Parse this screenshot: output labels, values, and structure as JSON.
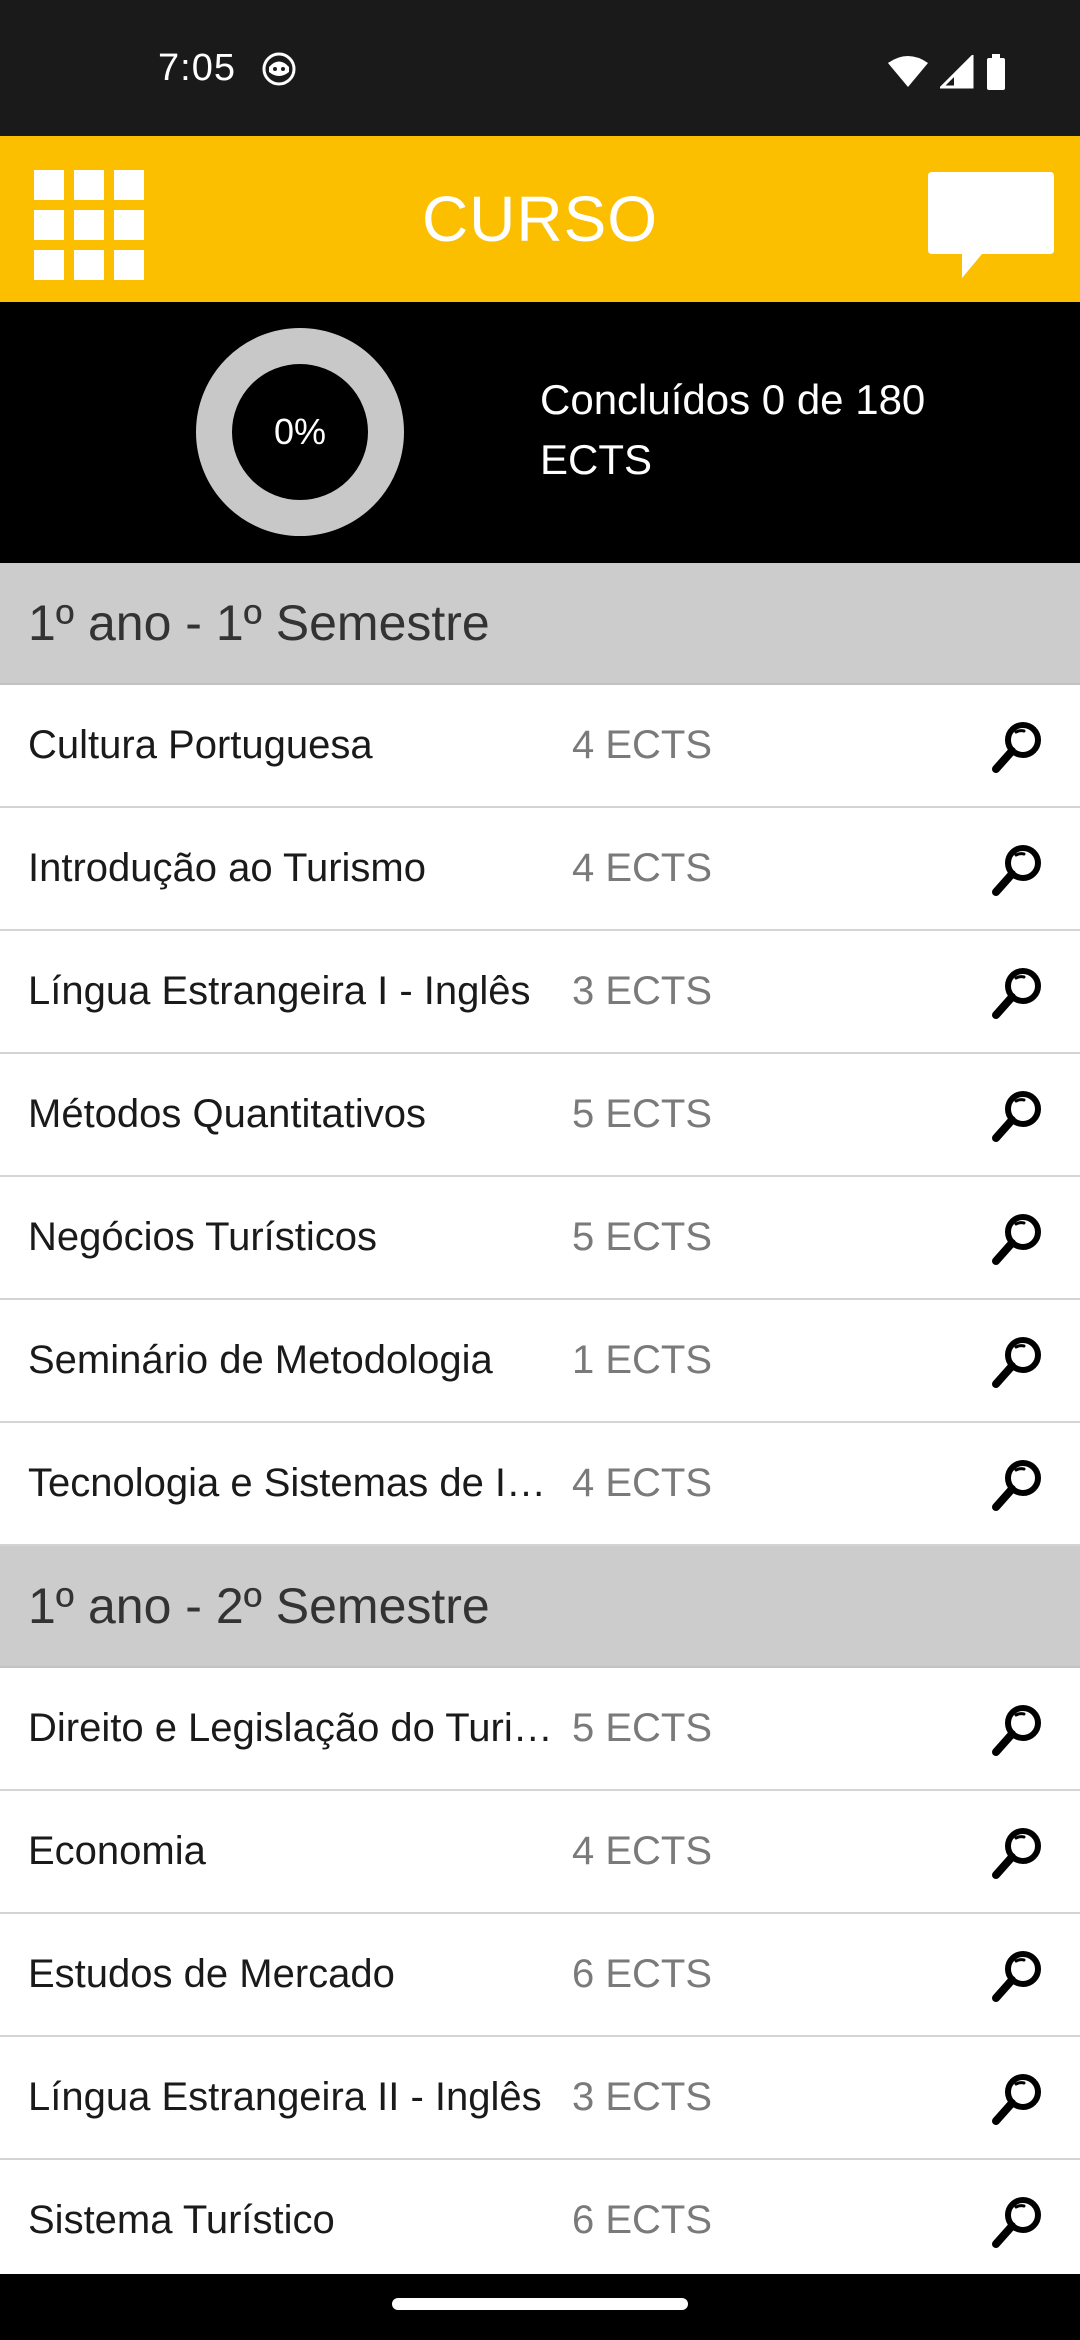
{
  "status_bar": {
    "time": "7:05"
  },
  "app_bar": {
    "title": "CURSO",
    "menu_icon": "grid-menu-icon",
    "chat_icon": "chat-bubble-icon",
    "background_color": "#fbbf00"
  },
  "progress": {
    "percent_label": "0%",
    "fraction": 0,
    "summary": "Concluídos 0 de 180 ECTS"
  },
  "sections": [
    {
      "title": "1º ano - 1º Semestre",
      "courses": [
        {
          "name": "Cultura Portuguesa",
          "ects": "4 ECTS"
        },
        {
          "name": "Introdução ao Turismo",
          "ects": "4 ECTS"
        },
        {
          "name": "Língua Estrangeira I - Inglês",
          "ects": "3 ECTS"
        },
        {
          "name": "Métodos Quantitativos",
          "ects": "5 ECTS"
        },
        {
          "name": "Negócios Turísticos",
          "ects": "5 ECTS"
        },
        {
          "name": "Seminário de Metodologia",
          "ects": "1 ECTS"
        },
        {
          "name": "Tecnologia e Sistemas de Inf...",
          "ects": "4 ECTS"
        }
      ]
    },
    {
      "title": "1º ano - 2º Semestre",
      "courses": [
        {
          "name": "Direito e Legislação do Turis...",
          "ects": "5 ECTS"
        },
        {
          "name": "Economia",
          "ects": "4 ECTS"
        },
        {
          "name": "Estudos de Mercado",
          "ects": "6 ECTS"
        },
        {
          "name": "Língua Estrangeira II - Inglês",
          "ects": "3 ECTS"
        },
        {
          "name": "Sistema Turístico",
          "ects": "6 ECTS"
        }
      ]
    }
  ]
}
